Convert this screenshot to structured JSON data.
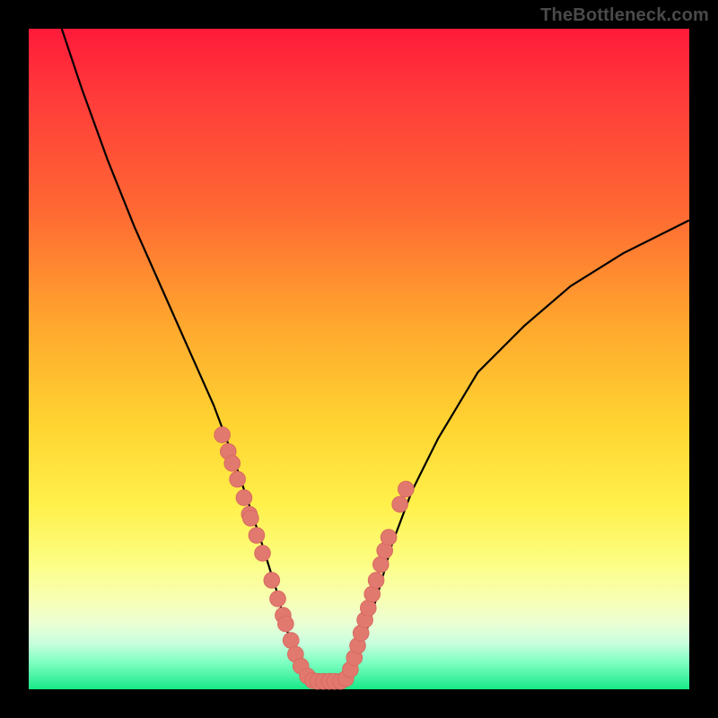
{
  "watermark": "TheBottleneck.com",
  "colors": {
    "dot_fill": "#e2796f",
    "dot_stroke": "#d86a60",
    "curve": "#000000"
  },
  "chart_data": {
    "type": "line",
    "title": "",
    "xlabel": "",
    "ylabel": "",
    "xlim": [
      0,
      100
    ],
    "ylim": [
      0,
      100
    ],
    "series": [
      {
        "name": "left-branch",
        "x": [
          5,
          8,
          12,
          16,
          20,
          24,
          28,
          31,
          33,
          35,
          37.5,
          38.8,
          40,
          41.5,
          43.5
        ],
        "y": [
          100,
          91,
          80,
          70,
          61,
          52,
          43,
          35,
          29,
          23,
          15,
          10,
          6,
          3,
          1.3
        ]
      },
      {
        "name": "right-branch",
        "x": [
          47.5,
          49,
          50.2,
          51.5,
          53,
          55,
          58,
          62,
          68,
          75,
          82,
          90,
          100
        ],
        "y": [
          1.3,
          3,
          6,
          10,
          15,
          22,
          30,
          38,
          48,
          55,
          61,
          66,
          71
        ]
      },
      {
        "name": "dots-left",
        "x": [
          29.3,
          30.2,
          30.8,
          31.6,
          32.6,
          33.4,
          33.6,
          34.5,
          35.4,
          36.8,
          37.7,
          38.5,
          38.9,
          39.7,
          40.4,
          41.2,
          42.2,
          43.0
        ],
        "y": [
          38.5,
          36.0,
          34.2,
          31.8,
          29.0,
          26.5,
          25.9,
          23.3,
          20.6,
          16.5,
          13.7,
          11.2,
          9.9,
          7.4,
          5.3,
          3.5,
          2.0,
          1.3
        ]
      },
      {
        "name": "dots-floor",
        "x": [
          43.7,
          44.6,
          45.5,
          46.3,
          47.2
        ],
        "y": [
          1.2,
          1.2,
          1.2,
          1.2,
          1.2
        ]
      },
      {
        "name": "dots-right",
        "x": [
          48.0,
          48.7,
          49.3,
          49.8,
          50.3,
          50.9,
          51.4,
          52.0,
          52.6,
          53.3,
          53.9,
          54.5,
          56.2,
          57.1
        ],
        "y": [
          1.6,
          3.0,
          4.8,
          6.6,
          8.5,
          10.5,
          12.3,
          14.4,
          16.5,
          18.9,
          21.0,
          23.0,
          28.0,
          30.3
        ]
      }
    ]
  }
}
